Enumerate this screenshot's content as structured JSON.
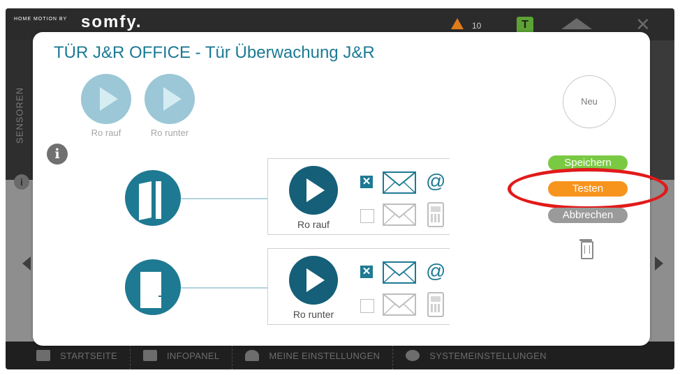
{
  "app": {
    "brand_tagline": "HOME MOTION BY",
    "brand_name": "somfy.",
    "alert_count": "10",
    "profile_badge": "T"
  },
  "side": {
    "label": "SENSOREN"
  },
  "bottom_nav": [
    "STARTSEITE",
    "INFOPANEL",
    "MEINE EINSTELLUNGEN",
    "SYSTEMEINSTELLUNGEN"
  ],
  "modal": {
    "title": "TÜR J&R OFFICE - Tür Überwachung J&R",
    "quick_scenarios": [
      {
        "label": "Ro rauf"
      },
      {
        "label": "Ro runter"
      }
    ],
    "new_button": "Neu",
    "save_button": "Speichern",
    "test_button": "Testen",
    "cancel_button": "Abbrechen",
    "rules": [
      {
        "door_state": "open",
        "scenario": "Ro rauf",
        "email_checked": true,
        "sms_checked": false
      },
      {
        "door_state": "closed",
        "scenario": "Ro runter",
        "email_checked": true,
        "sms_checked": false
      }
    ],
    "at_symbol": "@",
    "check_mark": "✕"
  },
  "colors": {
    "accent": "#1e7a92",
    "save": "#7ac943",
    "test": "#f7941d",
    "cancel": "#9a9a9a",
    "highlight_ring": "#e21a1a"
  },
  "icons": [
    "info-icon",
    "play-icon",
    "door-open-icon",
    "door-closed-icon",
    "email-icon",
    "at-icon",
    "phone-icon",
    "trash-icon",
    "home-icon",
    "close-icon",
    "warning-icon"
  ]
}
